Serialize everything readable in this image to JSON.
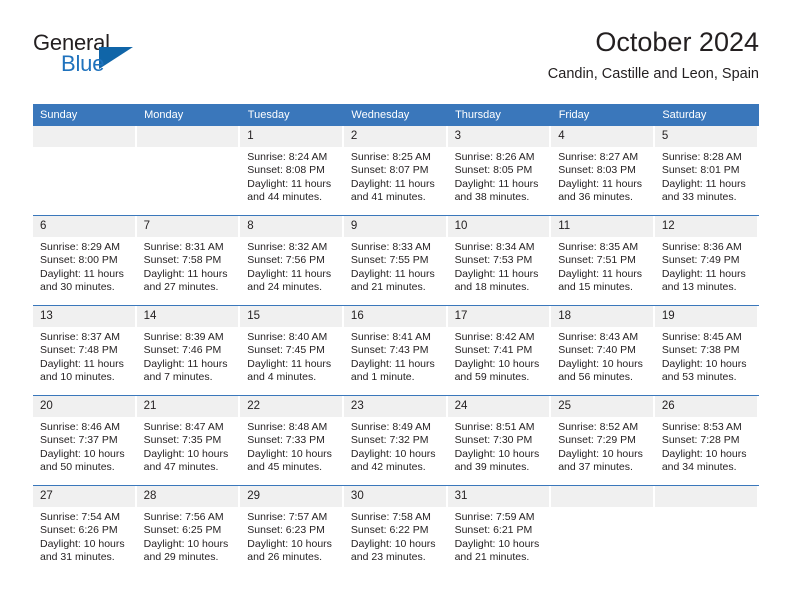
{
  "brand": {
    "name_top": "General",
    "name_bottom": "Blue",
    "accent_color": "#1f72bd",
    "triangle_color": "#1065a8"
  },
  "header": {
    "title": "October 2024",
    "subtitle": "Candin, Castille and Leon, Spain"
  },
  "theme": {
    "header_blue": "#3a77bb",
    "daynum_band": "#f0f0f0",
    "text": "#231f20"
  },
  "weekday_headers": [
    "Sunday",
    "Monday",
    "Tuesday",
    "Wednesday",
    "Thursday",
    "Friday",
    "Saturday"
  ],
  "labels": {
    "sunrise_prefix": "Sunrise:",
    "sunset_prefix": "Sunset:",
    "daylight_prefix": "Daylight:"
  },
  "weeks": [
    [
      {
        "day": "",
        "blank": true,
        "l1": "",
        "l2": "",
        "l3": "",
        "l4": ""
      },
      {
        "day": "",
        "blank": true,
        "l1": "",
        "l2": "",
        "l3": "",
        "l4": ""
      },
      {
        "day": "1",
        "l1": "Sunrise: 8:24 AM",
        "l2": "Sunset: 8:08 PM",
        "l3": "Daylight: 11 hours",
        "l4": "and 44 minutes."
      },
      {
        "day": "2",
        "l1": "Sunrise: 8:25 AM",
        "l2": "Sunset: 8:07 PM",
        "l3": "Daylight: 11 hours",
        "l4": "and 41 minutes."
      },
      {
        "day": "3",
        "l1": "Sunrise: 8:26 AM",
        "l2": "Sunset: 8:05 PM",
        "l3": "Daylight: 11 hours",
        "l4": "and 38 minutes."
      },
      {
        "day": "4",
        "l1": "Sunrise: 8:27 AM",
        "l2": "Sunset: 8:03 PM",
        "l3": "Daylight: 11 hours",
        "l4": "and 36 minutes."
      },
      {
        "day": "5",
        "l1": "Sunrise: 8:28 AM",
        "l2": "Sunset: 8:01 PM",
        "l3": "Daylight: 11 hours",
        "l4": "and 33 minutes."
      }
    ],
    [
      {
        "day": "6",
        "l1": "Sunrise: 8:29 AM",
        "l2": "Sunset: 8:00 PM",
        "l3": "Daylight: 11 hours",
        "l4": "and 30 minutes."
      },
      {
        "day": "7",
        "l1": "Sunrise: 8:31 AM",
        "l2": "Sunset: 7:58 PM",
        "l3": "Daylight: 11 hours",
        "l4": "and 27 minutes."
      },
      {
        "day": "8",
        "l1": "Sunrise: 8:32 AM",
        "l2": "Sunset: 7:56 PM",
        "l3": "Daylight: 11 hours",
        "l4": "and 24 minutes."
      },
      {
        "day": "9",
        "l1": "Sunrise: 8:33 AM",
        "l2": "Sunset: 7:55 PM",
        "l3": "Daylight: 11 hours",
        "l4": "and 21 minutes."
      },
      {
        "day": "10",
        "l1": "Sunrise: 8:34 AM",
        "l2": "Sunset: 7:53 PM",
        "l3": "Daylight: 11 hours",
        "l4": "and 18 minutes."
      },
      {
        "day": "11",
        "l1": "Sunrise: 8:35 AM",
        "l2": "Sunset: 7:51 PM",
        "l3": "Daylight: 11 hours",
        "l4": "and 15 minutes."
      },
      {
        "day": "12",
        "l1": "Sunrise: 8:36 AM",
        "l2": "Sunset: 7:49 PM",
        "l3": "Daylight: 11 hours",
        "l4": "and 13 minutes."
      }
    ],
    [
      {
        "day": "13",
        "l1": "Sunrise: 8:37 AM",
        "l2": "Sunset: 7:48 PM",
        "l3": "Daylight: 11 hours",
        "l4": "and 10 minutes."
      },
      {
        "day": "14",
        "l1": "Sunrise: 8:39 AM",
        "l2": "Sunset: 7:46 PM",
        "l3": "Daylight: 11 hours",
        "l4": "and 7 minutes."
      },
      {
        "day": "15",
        "l1": "Sunrise: 8:40 AM",
        "l2": "Sunset: 7:45 PM",
        "l3": "Daylight: 11 hours",
        "l4": "and 4 minutes."
      },
      {
        "day": "16",
        "l1": "Sunrise: 8:41 AM",
        "l2": "Sunset: 7:43 PM",
        "l3": "Daylight: 11 hours",
        "l4": "and 1 minute."
      },
      {
        "day": "17",
        "l1": "Sunrise: 8:42 AM",
        "l2": "Sunset: 7:41 PM",
        "l3": "Daylight: 10 hours",
        "l4": "and 59 minutes."
      },
      {
        "day": "18",
        "l1": "Sunrise: 8:43 AM",
        "l2": "Sunset: 7:40 PM",
        "l3": "Daylight: 10 hours",
        "l4": "and 56 minutes."
      },
      {
        "day": "19",
        "l1": "Sunrise: 8:45 AM",
        "l2": "Sunset: 7:38 PM",
        "l3": "Daylight: 10 hours",
        "l4": "and 53 minutes."
      }
    ],
    [
      {
        "day": "20",
        "l1": "Sunrise: 8:46 AM",
        "l2": "Sunset: 7:37 PM",
        "l3": "Daylight: 10 hours",
        "l4": "and 50 minutes."
      },
      {
        "day": "21",
        "l1": "Sunrise: 8:47 AM",
        "l2": "Sunset: 7:35 PM",
        "l3": "Daylight: 10 hours",
        "l4": "and 47 minutes."
      },
      {
        "day": "22",
        "l1": "Sunrise: 8:48 AM",
        "l2": "Sunset: 7:33 PM",
        "l3": "Daylight: 10 hours",
        "l4": "and 45 minutes."
      },
      {
        "day": "23",
        "l1": "Sunrise: 8:49 AM",
        "l2": "Sunset: 7:32 PM",
        "l3": "Daylight: 10 hours",
        "l4": "and 42 minutes."
      },
      {
        "day": "24",
        "l1": "Sunrise: 8:51 AM",
        "l2": "Sunset: 7:30 PM",
        "l3": "Daylight: 10 hours",
        "l4": "and 39 minutes."
      },
      {
        "day": "25",
        "l1": "Sunrise: 8:52 AM",
        "l2": "Sunset: 7:29 PM",
        "l3": "Daylight: 10 hours",
        "l4": "and 37 minutes."
      },
      {
        "day": "26",
        "l1": "Sunrise: 8:53 AM",
        "l2": "Sunset: 7:28 PM",
        "l3": "Daylight: 10 hours",
        "l4": "and 34 minutes."
      }
    ],
    [
      {
        "day": "27",
        "l1": "Sunrise: 7:54 AM",
        "l2": "Sunset: 6:26 PM",
        "l3": "Daylight: 10 hours",
        "l4": "and 31 minutes."
      },
      {
        "day": "28",
        "l1": "Sunrise: 7:56 AM",
        "l2": "Sunset: 6:25 PM",
        "l3": "Daylight: 10 hours",
        "l4": "and 29 minutes."
      },
      {
        "day": "29",
        "l1": "Sunrise: 7:57 AM",
        "l2": "Sunset: 6:23 PM",
        "l3": "Daylight: 10 hours",
        "l4": "and 26 minutes."
      },
      {
        "day": "30",
        "l1": "Sunrise: 7:58 AM",
        "l2": "Sunset: 6:22 PM",
        "l3": "Daylight: 10 hours",
        "l4": "and 23 minutes."
      },
      {
        "day": "31",
        "l1": "Sunrise: 7:59 AM",
        "l2": "Sunset: 6:21 PM",
        "l3": "Daylight: 10 hours",
        "l4": "and 21 minutes."
      },
      {
        "day": "",
        "blank": true,
        "l1": "",
        "l2": "",
        "l3": "",
        "l4": ""
      },
      {
        "day": "",
        "blank": true,
        "l1": "",
        "l2": "",
        "l3": "",
        "l4": ""
      }
    ]
  ]
}
